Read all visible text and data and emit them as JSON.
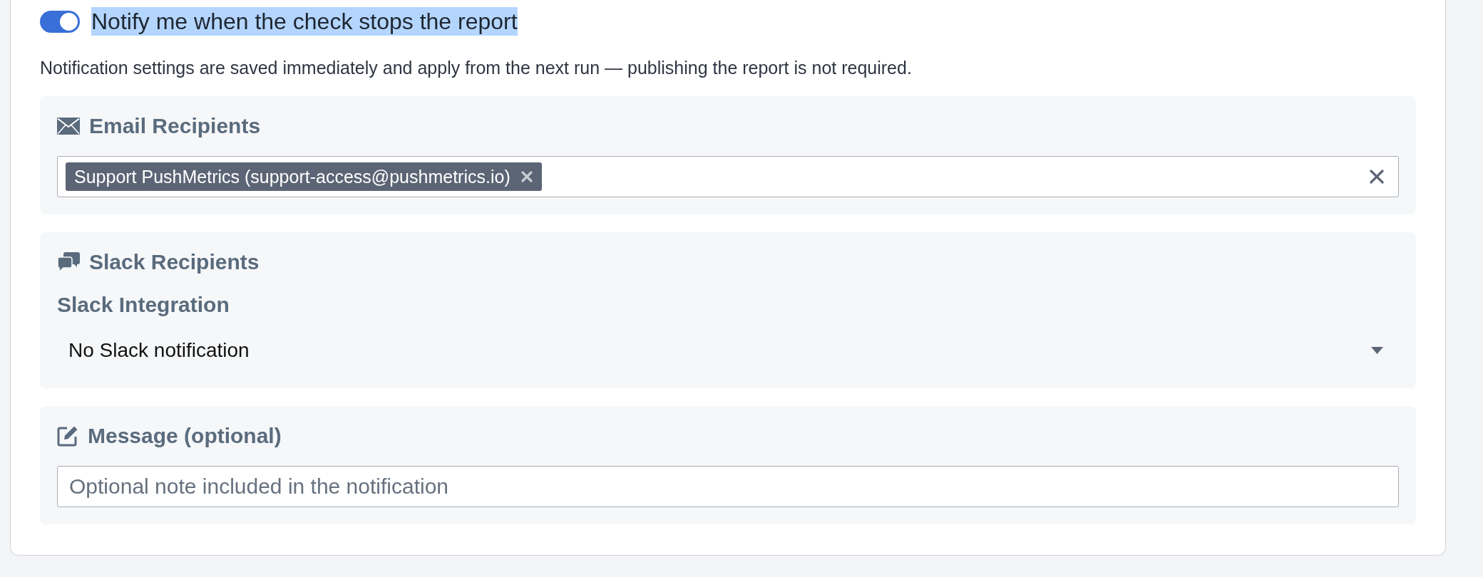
{
  "notify_toggle": {
    "on": true,
    "label": "Notify me when the check stops the report",
    "highlighted": true
  },
  "note": "Notification settings are saved immediately and apply from the next run — publishing the report is not required.",
  "sections": [
    {
      "kind": "email",
      "title": "Email Recipients",
      "recipients": [
        {
          "label": "Support PushMetrics (support-access@pushmetrics.io)"
        }
      ]
    },
    {
      "kind": "slack",
      "title": "Slack Recipients",
      "field_label": "Slack Integration",
      "value": "No Slack notification"
    },
    {
      "kind": "message",
      "title": "Message (optional)",
      "placeholder": "Optional note included in the notification"
    }
  ]
}
